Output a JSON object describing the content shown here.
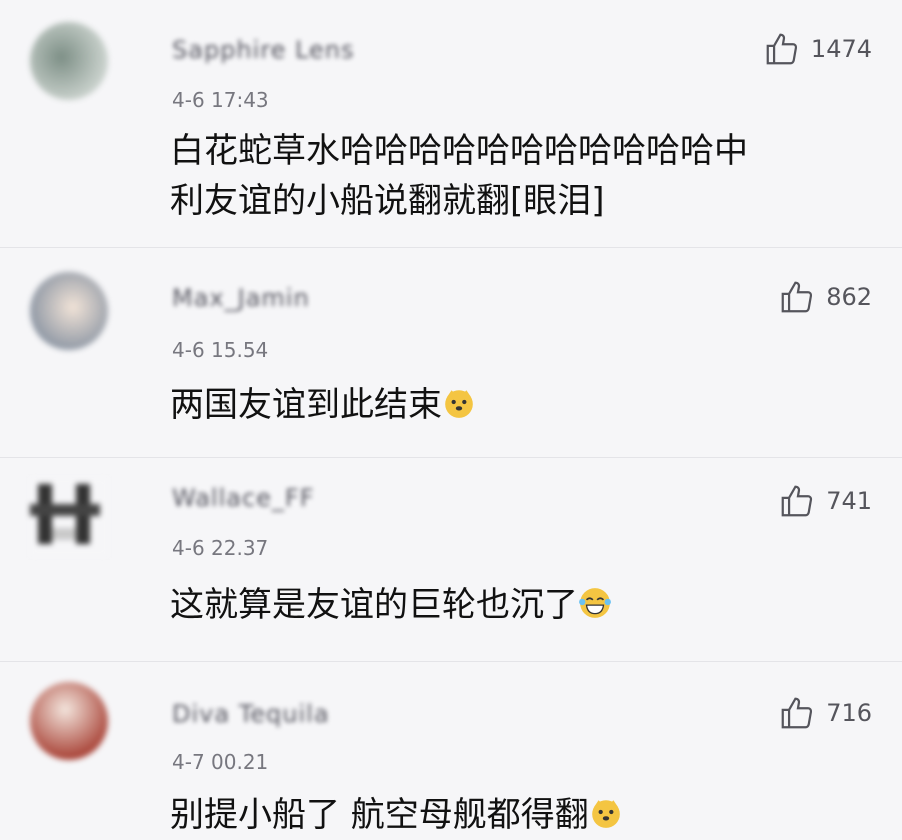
{
  "comments": [
    {
      "username": "Sapphire Lens",
      "time": "4-6 17:43",
      "body_line1": "白花蛇草水哈哈哈哈哈哈哈哈哈哈哈中",
      "body_line2": "利友谊的小船说翻就翻[眼泪]",
      "likes": "1474"
    },
    {
      "username": "Max_Jamin",
      "time": "4-6 15.54",
      "body": "两国友谊到此结束",
      "emoji": "doge-icon",
      "likes": "862"
    },
    {
      "username": "Wallace_FF",
      "time": "4-6 22.37",
      "body": "这就算是友谊的巨轮也沉了",
      "emoji": "laugh-cry-icon",
      "likes": "741"
    },
    {
      "username": "Diva Tequila",
      "time": "4-7 00.21",
      "body": "别提小船了 航空母舰都得翻",
      "emoji": "doge-icon",
      "likes": "716"
    }
  ]
}
